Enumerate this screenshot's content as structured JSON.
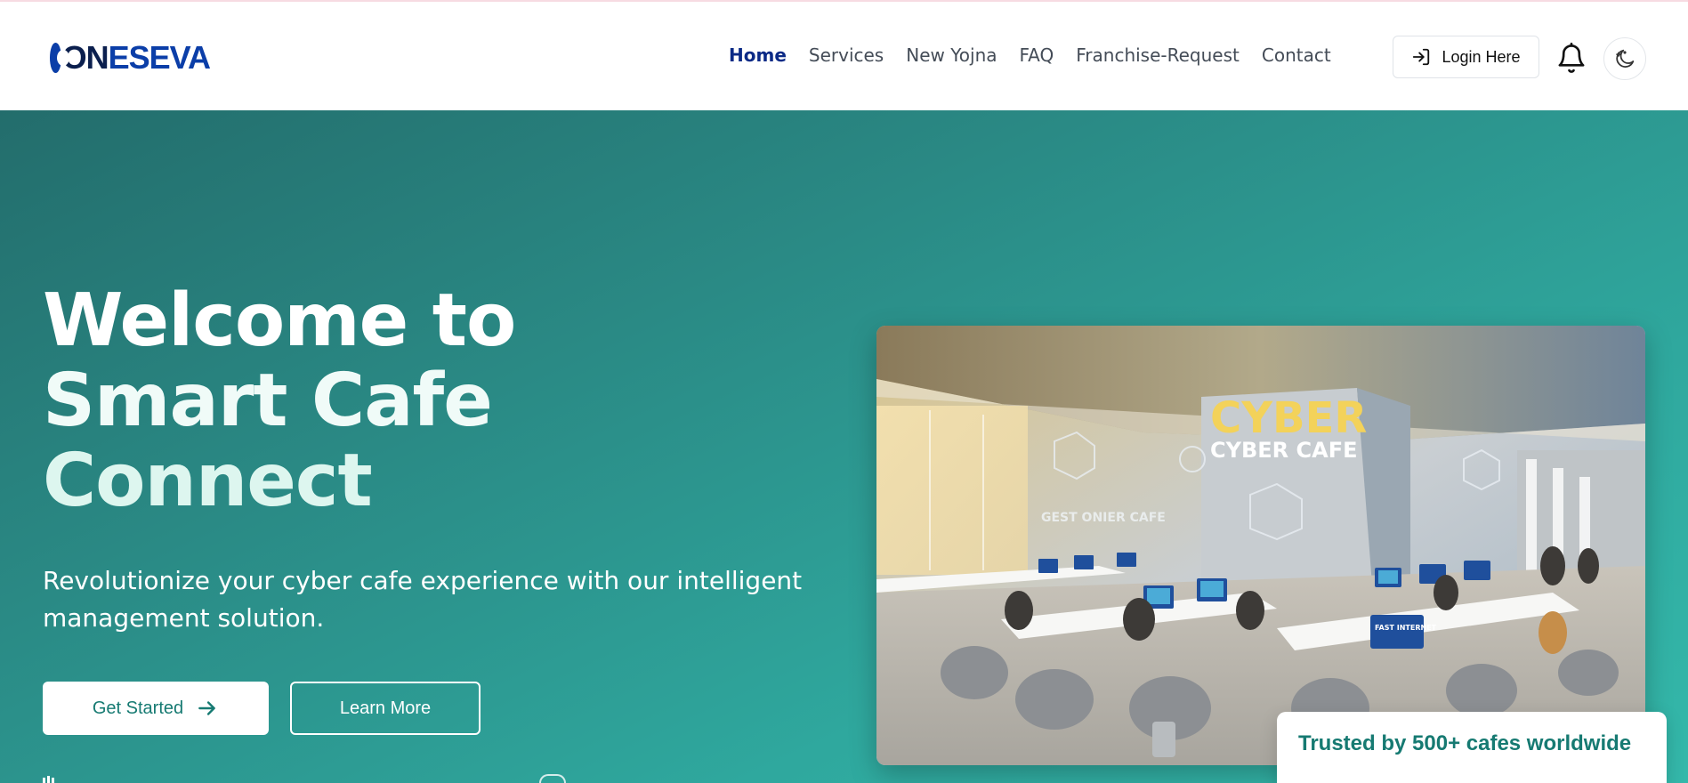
{
  "header": {
    "logo_text_left": "ON",
    "logo_text_right": "ESEVA",
    "nav": [
      {
        "label": "Home",
        "active": true
      },
      {
        "label": "Services",
        "active": false
      },
      {
        "label": "New Yojna",
        "active": false
      },
      {
        "label": "FAQ",
        "active": false
      },
      {
        "label": "Franchise-Request",
        "active": false
      },
      {
        "label": "Contact",
        "active": false
      }
    ],
    "login_label": "Login Here",
    "icons": [
      "login-arrow-icon",
      "bell-icon",
      "moon-stars-icon"
    ]
  },
  "hero": {
    "title_line1": "Welcome to",
    "title_line2": "Smart Cafe",
    "title_line3": "Connect",
    "subtitle": "Revolutionize your cyber cafe experience with our intelligent management solution.",
    "primary_button": "Get Started",
    "secondary_button": "Learn More",
    "trusted_text": "Trusted by 500+ cafes worldwide",
    "image_sign_main": "CYBER",
    "image_sign_sub": "CYBER CAFE",
    "image_sign_left": "GEST ONIER CAFE",
    "image_screen_text": "FAST INTERNET"
  },
  "colors": {
    "brand_blue": "#0b3ea8",
    "nav_active": "#0b2a86",
    "hero_gradient_start": "#236d6c",
    "hero_gradient_end": "#34b8aa",
    "teal_text": "#167a72"
  }
}
